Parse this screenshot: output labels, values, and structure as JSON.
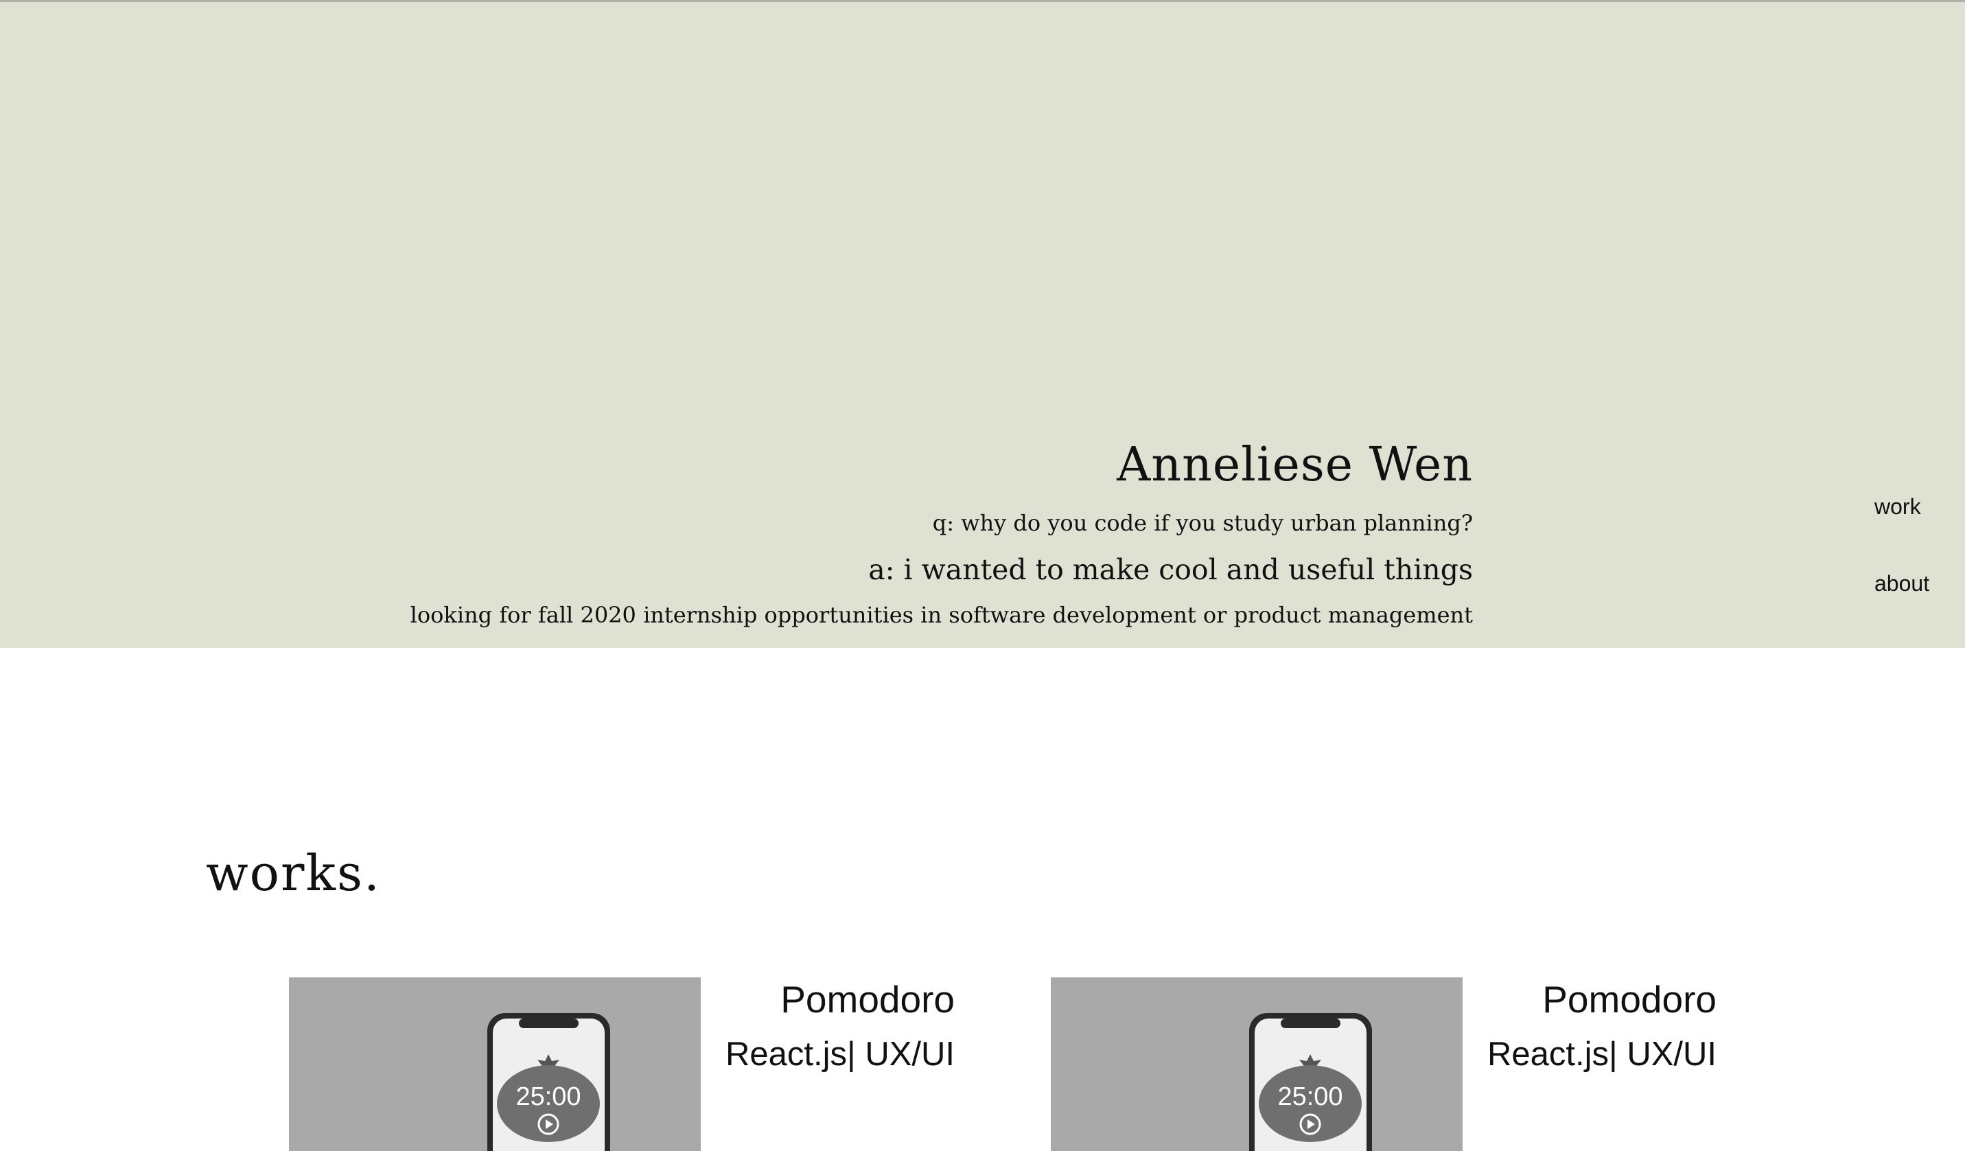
{
  "hero": {
    "name": "Anneliese Wen",
    "question": "q: why do you code if you study urban planning?",
    "answer": "a: i wanted to make cool and useful things",
    "looking": "looking for fall 2020 internship opportunities in software development or product management",
    "background_color": "#dfe2d3"
  },
  "nav": {
    "work_label": "work",
    "about_label": "about"
  },
  "works": {
    "heading": "works.",
    "projects": [
      {
        "title": "Pomodoro",
        "tags": "React.js| UX/UI",
        "timer": "25:00",
        "icon": "tomato-timer-phone-icon"
      },
      {
        "title": "Pomodoro",
        "tags": "React.js| UX/UI",
        "timer": "25:00",
        "icon": "tomato-timer-phone-icon"
      }
    ]
  }
}
